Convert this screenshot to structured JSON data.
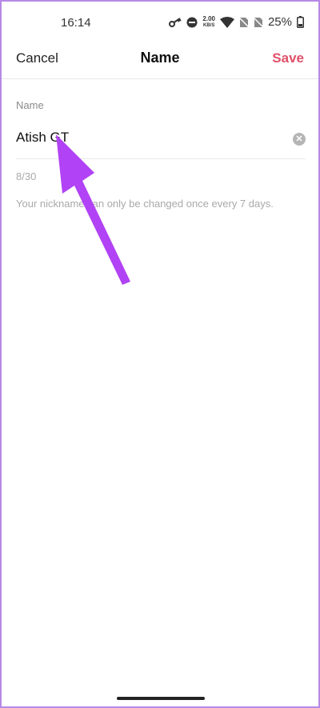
{
  "status_bar": {
    "time": "16:14",
    "net_speed_value": "2.00",
    "net_speed_unit": "KB/S",
    "battery": "25%",
    "icons": [
      "key-icon",
      "do-not-disturb-icon",
      "wifi-icon",
      "no-sim-icon",
      "no-sim-icon",
      "battery-icon"
    ]
  },
  "header": {
    "cancel_label": "Cancel",
    "title": "Name",
    "save_label": "Save"
  },
  "form": {
    "label": "Name",
    "value": "Atish GT",
    "char_count": "8/30",
    "helper": "Your nickname can only be changed once every 7 days."
  },
  "colors": {
    "accent": "#e0506a",
    "annotation_arrow": "#b142f5",
    "frame_border": "#b58ae6"
  }
}
